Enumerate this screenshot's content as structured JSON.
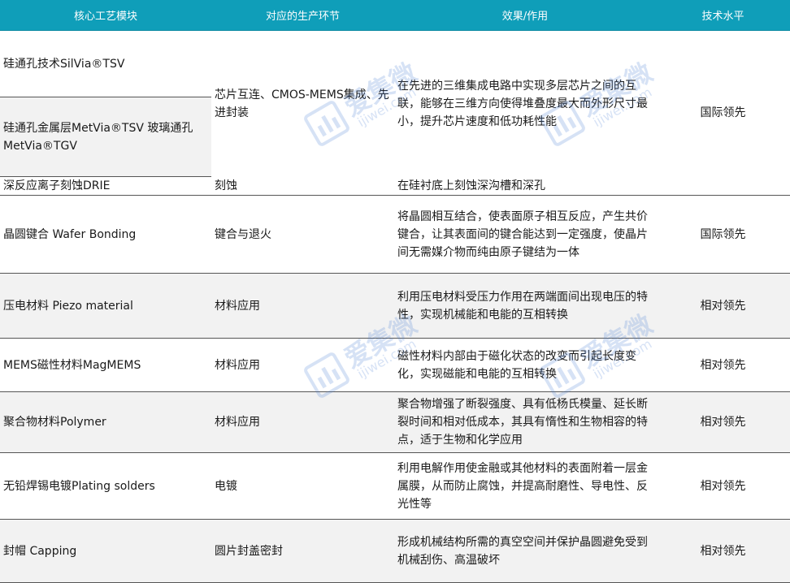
{
  "watermark": {
    "brand": "爱集微",
    "url": "ijiwei.com",
    "color": "#4b7fd6"
  },
  "colors": {
    "header_bg": "#0f9eb9",
    "header_text": "#ffffff",
    "row_grey": "#f2f2f2"
  },
  "table": {
    "headers": [
      "核心工艺模块",
      "对应的生产环节",
      "效果/作用",
      "技术水平"
    ],
    "rows": [
      {
        "module_a": "硅通孔技术SilVia®TSV",
        "module_b": "硅通孔金属层MetVia®TSV 玻璃通孔MetVia®TGV",
        "step": "芯片互连、CMOS-MEMS集成、先进封装",
        "effect": "在先进的三维集成电路中实现多层芯片之间的互联，能够在三维方向使得堆叠度最大而外形尺寸最小，提升芯片速度和低功耗性能",
        "level": "国际领先",
        "module_c": "深反应离子刻蚀DRIE",
        "step_c": "刻蚀",
        "effect_c": "在硅衬底上刻蚀深沟槽和深孔"
      },
      {
        "module": "晶圆键合 Wafer Bonding",
        "step": "键合与退火",
        "effect": "将晶圆相互结合，使表面原子相互反应，产生共价键合，让其表面间的键合能达到一定强度，使晶片间无需媒介物而纯由原子键结为一体",
        "level": "国际领先"
      },
      {
        "module": "压电材料 Piezo material",
        "step": "材料应用",
        "effect": "利用压电材料受压力作用在两端面间出现电压的特性，实现机械能和电能的互相转换",
        "level": "相对领先"
      },
      {
        "module": "MEMS磁性材料MagMEMS",
        "step": "材料应用",
        "effect": "磁性材料内部由于磁化状态的改变而引起长度变化，实现磁能和电能的互相转换",
        "level": "相对领先"
      },
      {
        "module": "聚合物材料Polymer",
        "step": "材料应用",
        "effect": "聚合物增强了断裂强度、具有低杨氏模量、延长断裂时间和相对低成本，其具有惰性和生物相容的特点，适于生物和化学应用",
        "level": "相对领先"
      },
      {
        "module": "无铅焊锡电镀Plating solders",
        "step": "电镀",
        "effect": "利用电解作用使金融或其他材料的表面附着一层金属膜，从而防止腐蚀，并提高耐磨性、导电性、反光性等",
        "level": "相对领先"
      },
      {
        "module": "封帽 Capping",
        "step": "圆片封盖密封",
        "effect": "形成机械结构所需的真空空间并保护晶圆避免受到机械刮伤、高温破坏",
        "level": "相对领先"
      }
    ]
  }
}
